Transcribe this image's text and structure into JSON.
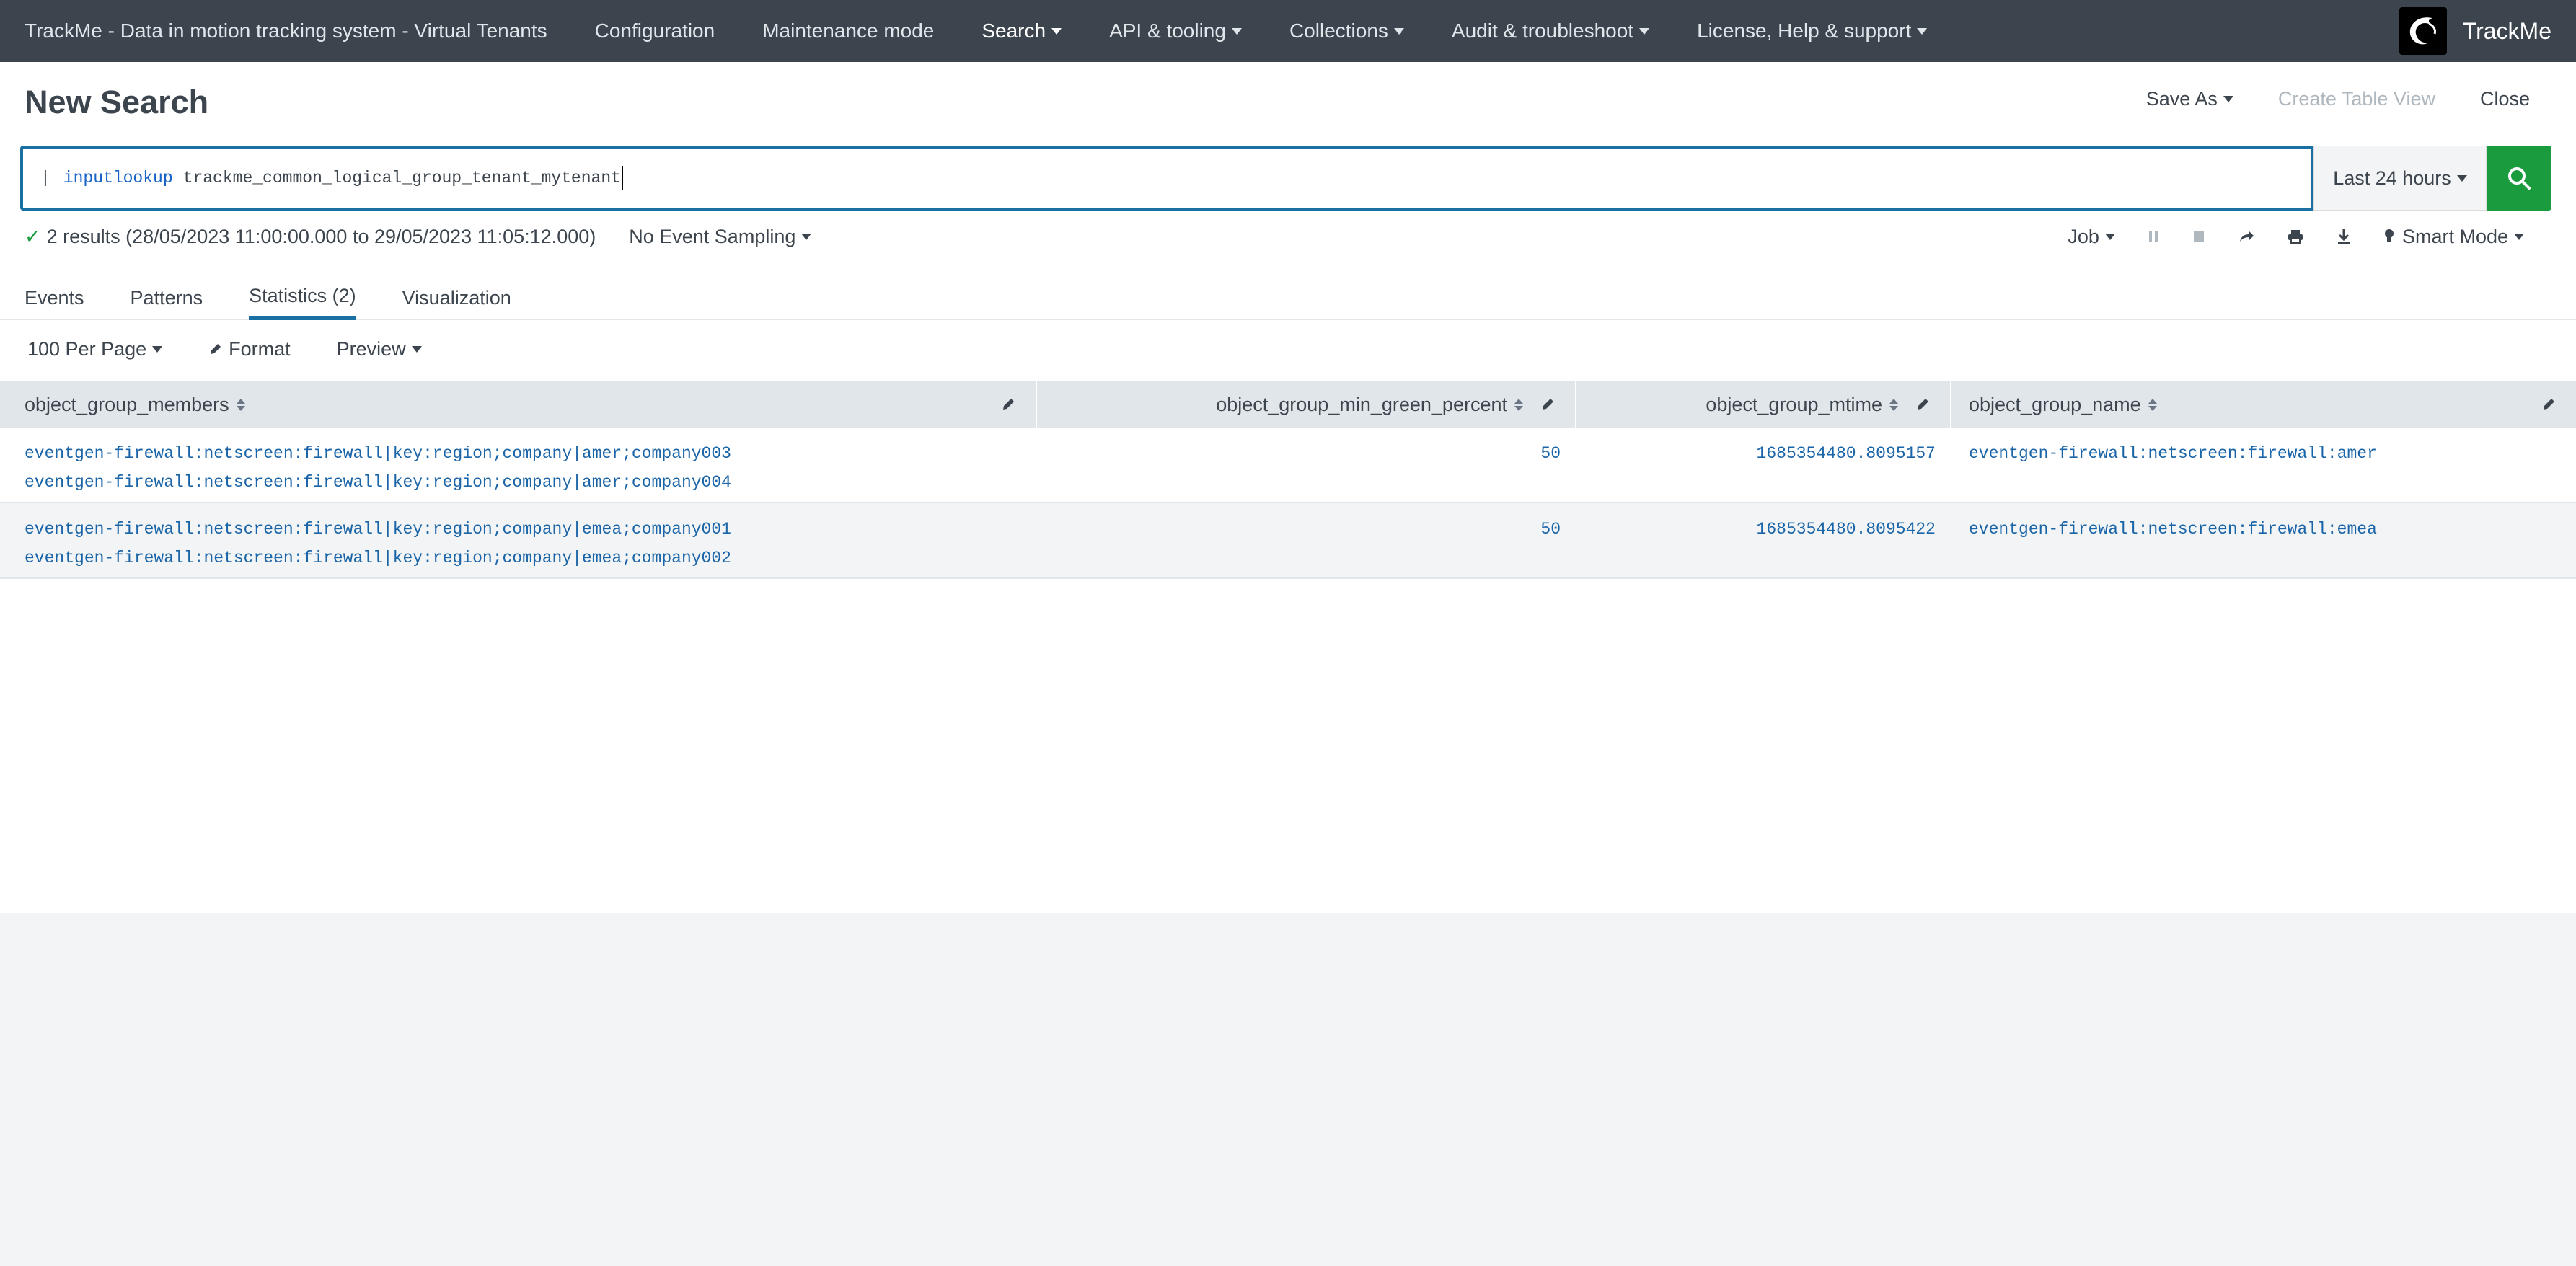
{
  "nav": {
    "title": "TrackMe - Data in motion tracking system - Virtual Tenants",
    "items": [
      {
        "label": "Configuration",
        "caret": false
      },
      {
        "label": "Maintenance mode",
        "caret": false
      },
      {
        "label": "Search",
        "caret": true
      },
      {
        "label": "API & tooling",
        "caret": true
      },
      {
        "label": "Collections",
        "caret": true
      },
      {
        "label": "Audit & troubleshoot",
        "caret": true
      },
      {
        "label": "License, Help & support",
        "caret": true
      }
    ],
    "brand": "TrackMe"
  },
  "page": {
    "title": "New Search",
    "save_as": "Save As",
    "create_table_view": "Create Table View",
    "close": "Close"
  },
  "search": {
    "pipe": "|",
    "command": "inputlookup",
    "argument": "trackme_common_logical_group_tenant_mytenant",
    "time_range": "Last 24 hours"
  },
  "status": {
    "check": "✓",
    "results": "2 results (28/05/2023 11:00:00.000 to 29/05/2023 11:05:12.000)",
    "sampling": "No Event Sampling",
    "job": "Job",
    "mode": "Smart Mode"
  },
  "tabs": {
    "events": "Events",
    "patterns": "Patterns",
    "statistics": "Statistics (2)",
    "visualization": "Visualization"
  },
  "toolbar": {
    "per_page": "100 Per Page",
    "format": "Format",
    "preview": "Preview"
  },
  "table": {
    "columns": [
      "object_group_members",
      "object_group_min_green_percent",
      "object_group_mtime",
      "object_group_name"
    ],
    "rows": [
      {
        "members": [
          "eventgen-firewall:netscreen:firewall|key:region;company|amer;company003",
          "eventgen-firewall:netscreen:firewall|key:region;company|amer;company004"
        ],
        "min_green_percent": "50",
        "mtime": "1685354480.8095157",
        "name": "eventgen-firewall:netscreen:firewall:amer"
      },
      {
        "members": [
          "eventgen-firewall:netscreen:firewall|key:region;company|emea;company001",
          "eventgen-firewall:netscreen:firewall|key:region;company|emea;company002"
        ],
        "min_green_percent": "50",
        "mtime": "1685354480.8095422",
        "name": "eventgen-firewall:netscreen:firewall:emea"
      }
    ]
  },
  "colors": {
    "nav_bg": "#3c444d",
    "accent": "#1a6fa3",
    "search_button": "#1a9c3e",
    "link": "#1a64a8"
  }
}
